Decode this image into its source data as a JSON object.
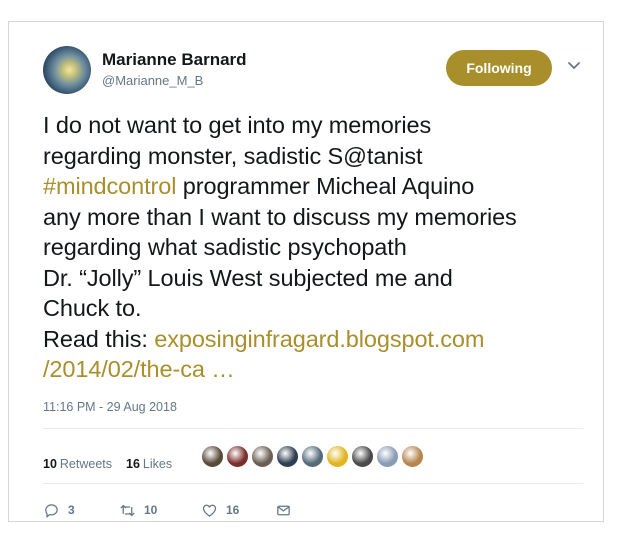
{
  "author": {
    "name": "Marianne Barnard",
    "handle": "@Marianne_M_B"
  },
  "follow_label": "Following",
  "tweet": {
    "lines": [
      [
        {
          "t": "I do not want to get into my memories"
        }
      ],
      [
        {
          "t": "regarding monster, sadistic S@tanist"
        }
      ],
      [
        {
          "t": "#mindcontrol",
          "link": true
        },
        {
          "t": " programmer Micheal Aquino"
        }
      ],
      [
        {
          "t": "any more than I want to discuss my memories"
        }
      ],
      [
        {
          "t": "regarding what sadistic psychopath"
        }
      ],
      [
        {
          "t": "Dr. “Jolly” Louis West subjected me and"
        }
      ],
      [
        {
          "t": "Chuck to."
        }
      ],
      [
        {
          "t": "Read this: "
        },
        {
          "t": "exposinginfragard.blogspot.com",
          "link": true
        }
      ],
      [
        {
          "t": "/2014/02/the-ca …",
          "link": true
        }
      ]
    ]
  },
  "timestamp": "11:16 PM - 29 Aug 2018",
  "stats": {
    "retweets_count": "10",
    "retweets_label": "Retweets",
    "likes_count": "16",
    "likes_label": "Likes"
  },
  "likers": [
    "#5a4a3a",
    "#7a2e2e",
    "#6b5f55",
    "#2c3e50",
    "#556b7a",
    "#e0b520",
    "#4a4a4a",
    "#8a9bb5",
    "#b5874f"
  ],
  "actions": {
    "reply": "3",
    "retweet": "10",
    "like": "16"
  },
  "colors": {
    "accent": "#a88f2c",
    "muted": "#657786",
    "text": "#14171a"
  }
}
